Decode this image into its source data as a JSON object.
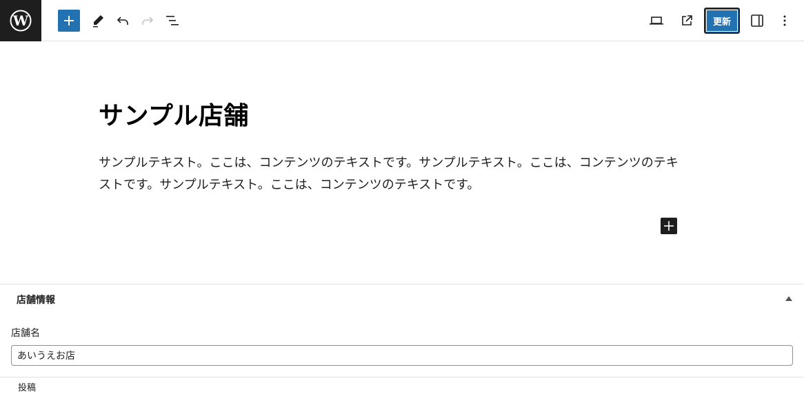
{
  "header": {
    "add_block_label": "Add block",
    "tools_label": "Tools",
    "undo_label": "Undo",
    "redo_label": "Redo",
    "list_view_label": "List View",
    "preview_label": "Preview",
    "view_post_label": "View Post",
    "update_button": "更新",
    "settings_label": "Settings",
    "options_label": "Options"
  },
  "post": {
    "title": "サンプル店舗",
    "paragraph": "サンプルテキスト。ここは、コンテンツのテキストです。サンプルテキスト。ここは、コンテンツのテキストです。サンプルテキスト。ここは、コンテンツのテキストです。"
  },
  "metabox": {
    "title": "店舗情報",
    "field_label": "店舗名",
    "field_value": "あいうえお店"
  },
  "footer": {
    "breadcrumb": "投稿"
  },
  "colors": {
    "accent": "#2271b1",
    "dark": "#1e1e1e",
    "border": "#e0e0e0"
  }
}
